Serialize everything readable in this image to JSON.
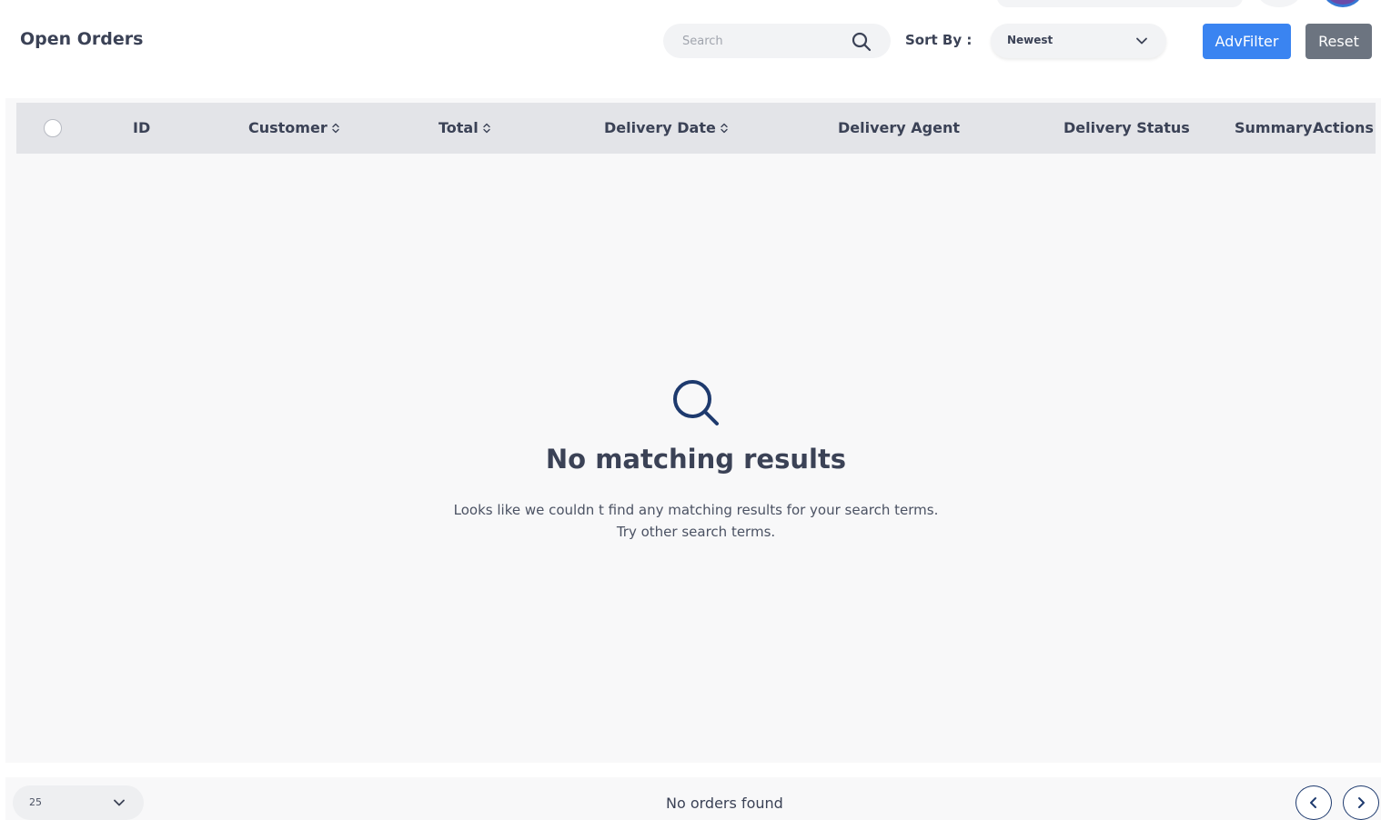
{
  "header": {
    "title": "Open Orders",
    "search": {
      "placeholder": "Search",
      "value": ""
    },
    "sort_label": "Sort By :",
    "sort_value": "Newest",
    "adv_filter_label": "AdvFilter",
    "reset_label": "Reset"
  },
  "table": {
    "columns": [
      {
        "label": "ID",
        "sortable": false
      },
      {
        "label": "Customer",
        "sortable": true
      },
      {
        "label": "Total",
        "sortable": true
      },
      {
        "label": "Delivery Date",
        "sortable": true
      },
      {
        "label": "Delivery Agent",
        "sortable": false
      },
      {
        "label": "Delivery Status",
        "sortable": false
      },
      {
        "label": "Summary",
        "sortable": false
      },
      {
        "label": "Actions",
        "sortable": false
      }
    ],
    "rows": []
  },
  "empty_state": {
    "icon": "search-icon",
    "title": "No matching results",
    "line1": "Looks like we couldn t find any matching results for your search terms.",
    "line2": "Try other search terms."
  },
  "footer": {
    "per_page": "25",
    "status": "No orders found"
  },
  "colors": {
    "primary": "#3a84f1",
    "secondary": "#6c7480",
    "header_bg": "#e3e4e8",
    "text": "#3b4256",
    "icon_dark": "#1e3a6e"
  }
}
